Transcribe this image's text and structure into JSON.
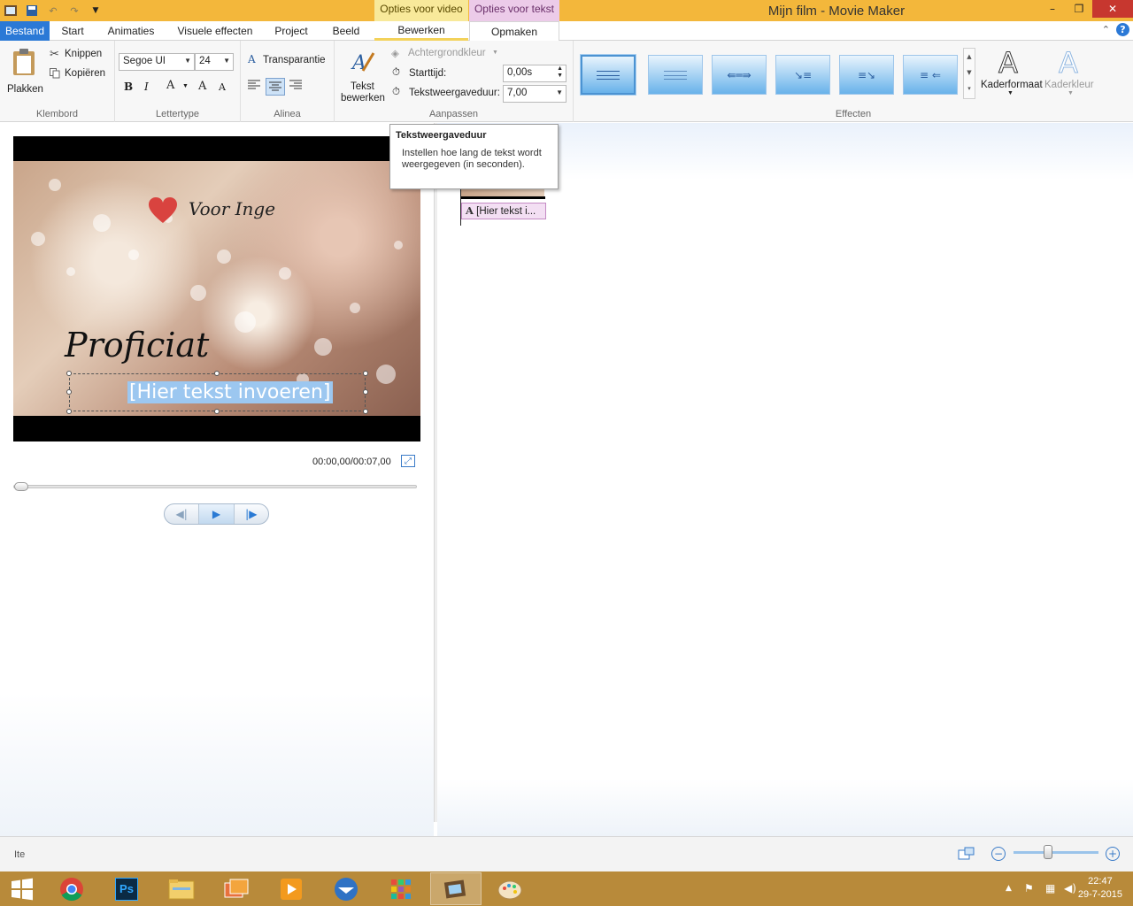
{
  "window": {
    "title": "Mijn film - Movie Maker",
    "minimize": "–",
    "maximize": "❐",
    "close": "✕",
    "ribbon_collapse": "⌃",
    "help": "?"
  },
  "contextual_groups": {
    "video": "Opties voor video",
    "text": "Opties voor tekst"
  },
  "tabs": [
    "Bestand",
    "Start",
    "Animaties",
    "Visuele effecten",
    "Project",
    "Beeld",
    "Bewerken",
    "Opmaken"
  ],
  "active_tab": "Opmaken",
  "ribbon": {
    "klembord": {
      "label": "Klembord",
      "paste": "Plakken",
      "cut": "Knippen",
      "copy": "Kopiëren"
    },
    "lettertype": {
      "label": "Lettertype",
      "font": "Segoe UI",
      "size": "24",
      "bold": "B",
      "italic": "I",
      "color": "A",
      "grow": "A",
      "shrink": "A",
      "transparency": "Transparantie"
    },
    "alinea": {
      "label": "Alinea"
    },
    "aanpassen": {
      "label": "Aanpassen",
      "edit_text_line1": "Tekst",
      "edit_text_line2": "bewerken",
      "background_color": "Achtergrondkleur",
      "start_time_label": "Starttijd:",
      "start_time_value": "0,00s",
      "duration_label": "Tekstweergaveduur:",
      "duration_value": "7,00"
    },
    "effecten": {
      "label": "Effecten",
      "frame_format": "Kaderformaat",
      "frame_color": "Kaderkleur"
    }
  },
  "tooltip": {
    "title": "Tekstweergaveduur",
    "body": "Instellen hoe lang de tekst wordt weergegeven (in seconden)."
  },
  "preview": {
    "overlay_dedication": "Voor Inge",
    "overlay_title": "Proficiat",
    "placeholder_text": "[Hier tekst invoeren]",
    "timecode": "00:00,00/00:07,00",
    "seek_position": 0
  },
  "storyboard": {
    "caption_clip": "[Hier tekst i..."
  },
  "statusbar": {
    "text": "Ite",
    "zoom_out": "−",
    "zoom_in": "+",
    "zoom_level": 0.42
  },
  "taskbar": {
    "apps": [
      "Windows",
      "Chrome",
      "Photoshop",
      "Verkenner",
      "Galerie",
      "VLC",
      "Thunderbird",
      "Apps",
      "Movie Maker",
      "Paint"
    ],
    "time": "22:47",
    "date": "29-7-2015"
  },
  "colors": {
    "title_bar": "#f3b73b",
    "file_tab": "#2b79d6",
    "context_video": "#f8e99a",
    "context_text": "#eccbe9",
    "taskbar": "#b88a3a"
  }
}
